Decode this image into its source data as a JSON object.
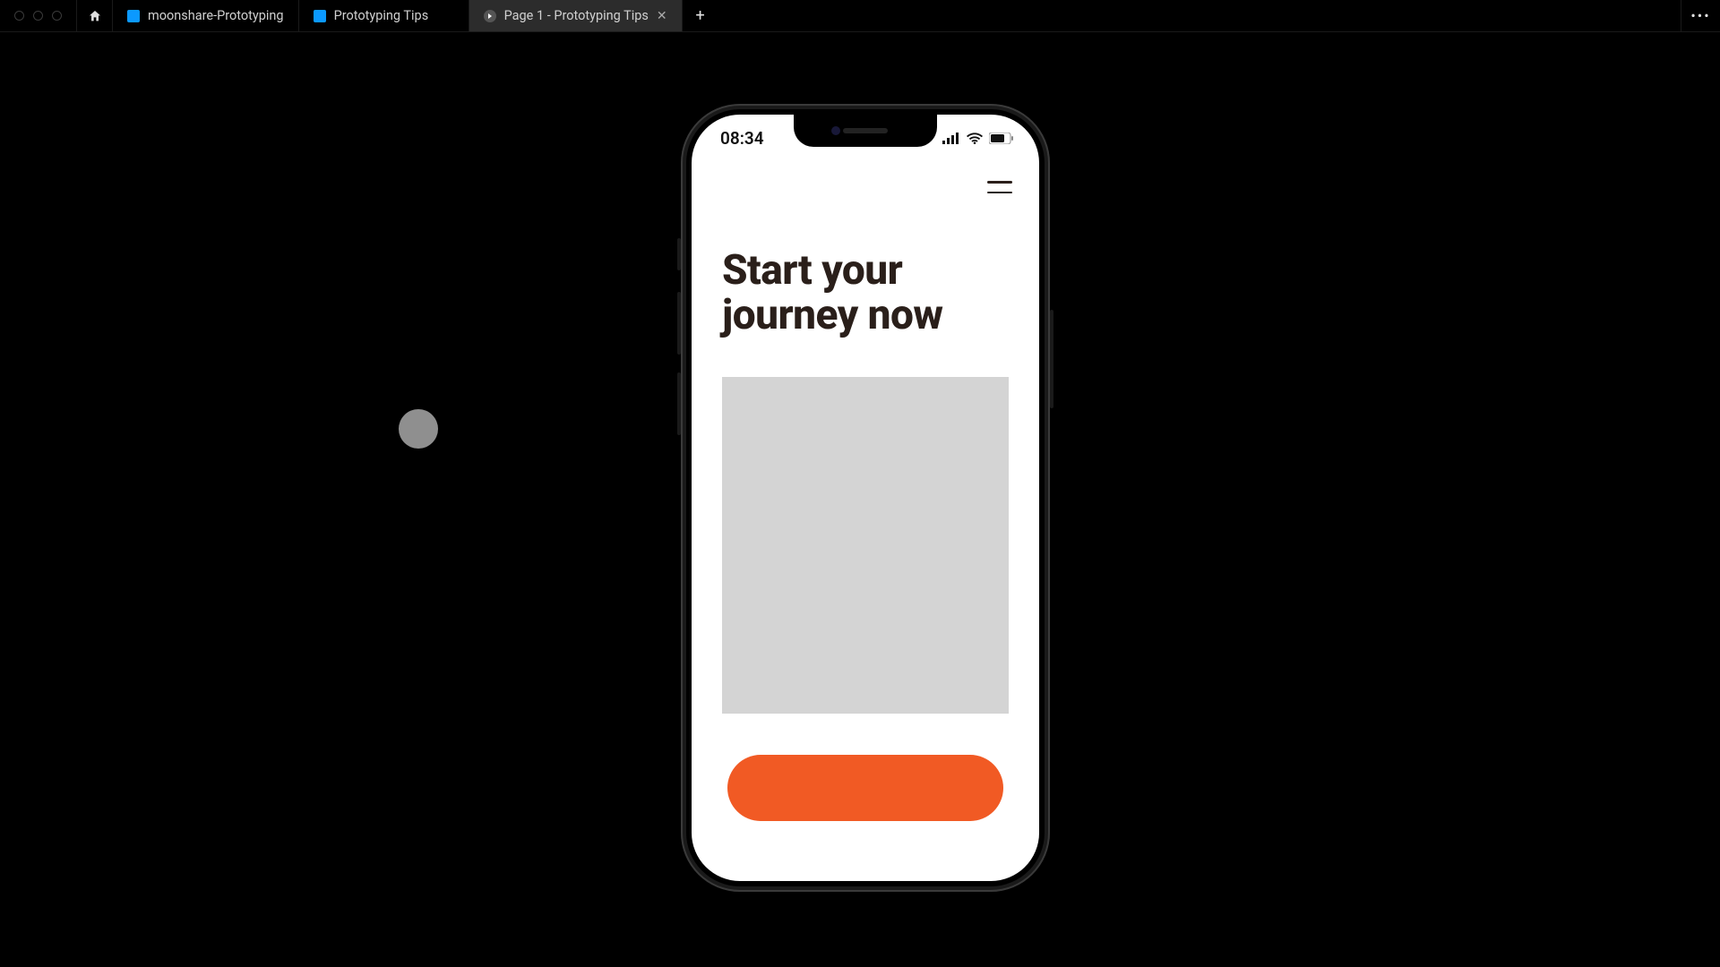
{
  "tabs": [
    {
      "label": "moonshare-Prototyping",
      "type": "doc",
      "active": false
    },
    {
      "label": "Prototyping Tips",
      "type": "doc",
      "active": false
    },
    {
      "label": "Page 1 - Prototyping Tips",
      "type": "play",
      "active": true
    }
  ],
  "phone": {
    "status_time": "08:34",
    "hero_title_line1": "Start your",
    "hero_title_line2": "journey now",
    "cta_label": ""
  }
}
